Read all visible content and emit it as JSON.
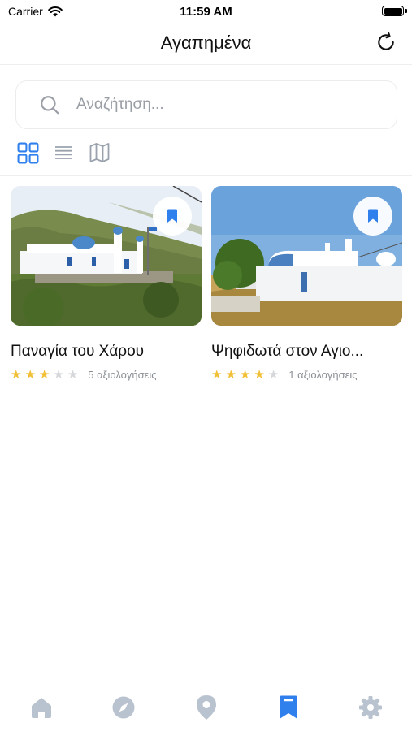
{
  "status_bar": {
    "carrier": "Carrier",
    "time": "11:59 AM"
  },
  "header": {
    "title": "Αγαπημένα",
    "refresh_icon": "refresh-icon"
  },
  "search": {
    "placeholder": "Αναζήτηση...",
    "value": ""
  },
  "view_modes": [
    {
      "icon": "grid-icon",
      "active": true
    },
    {
      "icon": "list-icon",
      "active": false
    },
    {
      "icon": "map-icon",
      "active": false
    }
  ],
  "favorites": [
    {
      "title": "Παναγία του Χάρου",
      "rating": 3,
      "max_rating": 5,
      "reviews": "5 αξιολογήσεις",
      "bookmarked": true
    },
    {
      "title": "Ψηφιδωτά στον Αγιο...",
      "rating": 4,
      "max_rating": 5,
      "reviews": "1 αξιολογήσεις",
      "bookmarked": true
    }
  ],
  "tab_bar": {
    "items": [
      {
        "icon": "home-icon",
        "active": false
      },
      {
        "icon": "compass-icon",
        "active": false
      },
      {
        "icon": "location-pin-icon",
        "active": false
      },
      {
        "icon": "bookmark-icon",
        "active": true
      },
      {
        "icon": "gear-icon",
        "active": false
      }
    ]
  },
  "colors": {
    "accent": "#2f80ed",
    "inactive_icon": "#b9c3cf",
    "star": "#f2c037",
    "star_empty": "#d5d7da"
  }
}
